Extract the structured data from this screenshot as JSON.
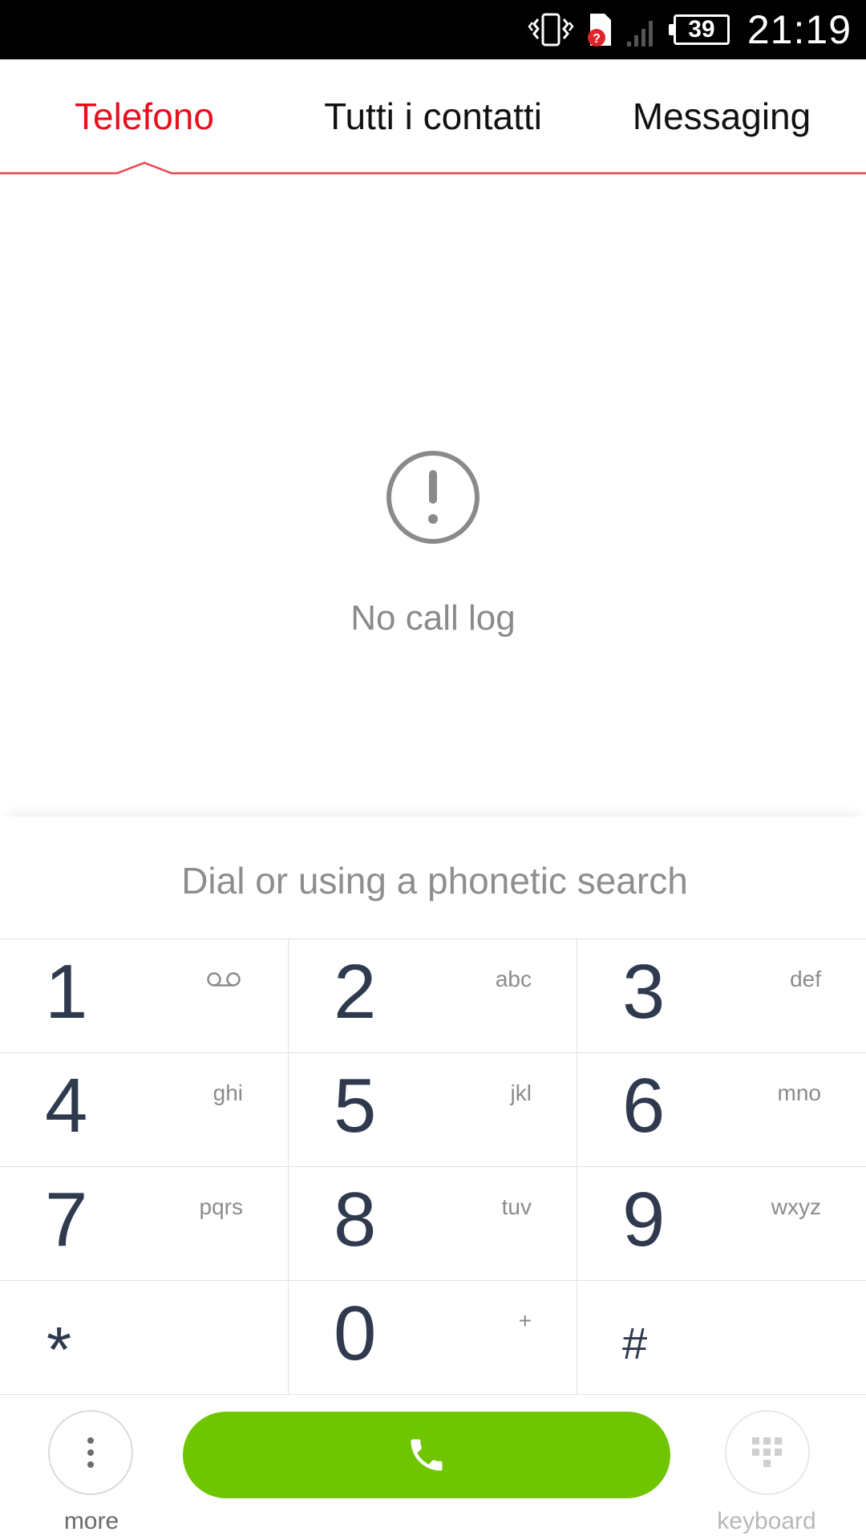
{
  "status_bar": {
    "battery_level": "39",
    "time": "21:19",
    "icons": [
      "vibrate-icon",
      "sim-error-icon",
      "signal-icon",
      "battery-icon"
    ]
  },
  "tabs": [
    {
      "label": "Telefono",
      "active": true
    },
    {
      "label": "Tutti i contatti",
      "active": false
    },
    {
      "label": "Messaging",
      "active": false
    }
  ],
  "empty_state": {
    "icon": "alert-circle-icon",
    "message": "No call log"
  },
  "dial": {
    "placeholder": "Dial or using a phonetic search",
    "value": ""
  },
  "keypad": {
    "keys": [
      {
        "digit": "1",
        "letters": "",
        "icon": "voicemail-icon"
      },
      {
        "digit": "2",
        "letters": "abc"
      },
      {
        "digit": "3",
        "letters": "def"
      },
      {
        "digit": "4",
        "letters": "ghi"
      },
      {
        "digit": "5",
        "letters": "jkl"
      },
      {
        "digit": "6",
        "letters": "mno"
      },
      {
        "digit": "7",
        "letters": "pqrs"
      },
      {
        "digit": "8",
        "letters": "tuv"
      },
      {
        "digit": "9",
        "letters": "wxyz"
      },
      {
        "digit": "*",
        "letters": ""
      },
      {
        "digit": "0",
        "letters": "+"
      },
      {
        "digit": "#",
        "letters": ""
      }
    ]
  },
  "bottom_bar": {
    "more_label": "more",
    "keyboard_label": "keyboard",
    "call_icon": "phone-icon"
  },
  "colors": {
    "accent": "#e8101c",
    "call_green": "#6fc500",
    "digit_color": "#2f3a4f"
  }
}
